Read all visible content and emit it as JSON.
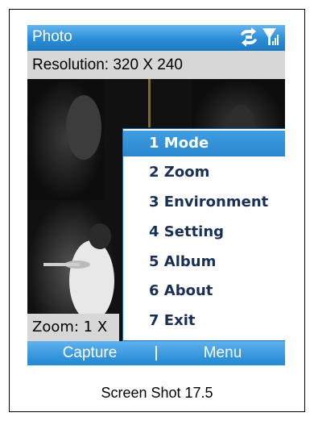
{
  "app": {
    "title": "Photo"
  },
  "status_icons": [
    "sync-icon",
    "signal-icon"
  ],
  "resolution": {
    "text": "Resolution: 320 X 240"
  },
  "zoom": {
    "text": "Zoom: 1 X"
  },
  "menu": {
    "items": [
      {
        "label": "1 Mode",
        "has_submenu": true,
        "selected": true
      },
      {
        "label": "2 Zoom",
        "has_submenu": true,
        "selected": false
      },
      {
        "label": "3 Environment",
        "has_submenu": true,
        "selected": false
      },
      {
        "label": "4 Setting",
        "has_submenu": true,
        "selected": false
      },
      {
        "label": "5 Album",
        "has_submenu": false,
        "selected": false
      },
      {
        "label": "6 About",
        "has_submenu": false,
        "selected": false
      },
      {
        "label": "7 Exit",
        "has_submenu": false,
        "selected": false
      }
    ]
  },
  "softkeys": {
    "left": "Capture",
    "right": "Menu"
  },
  "caption": "Screen Shot 17.5",
  "colors": {
    "title_bar": "#2b8ed6",
    "menu_highlight": "#3f9ee2",
    "menu_text": "#1a2f55",
    "bar_gray": "#d7d7d7"
  }
}
